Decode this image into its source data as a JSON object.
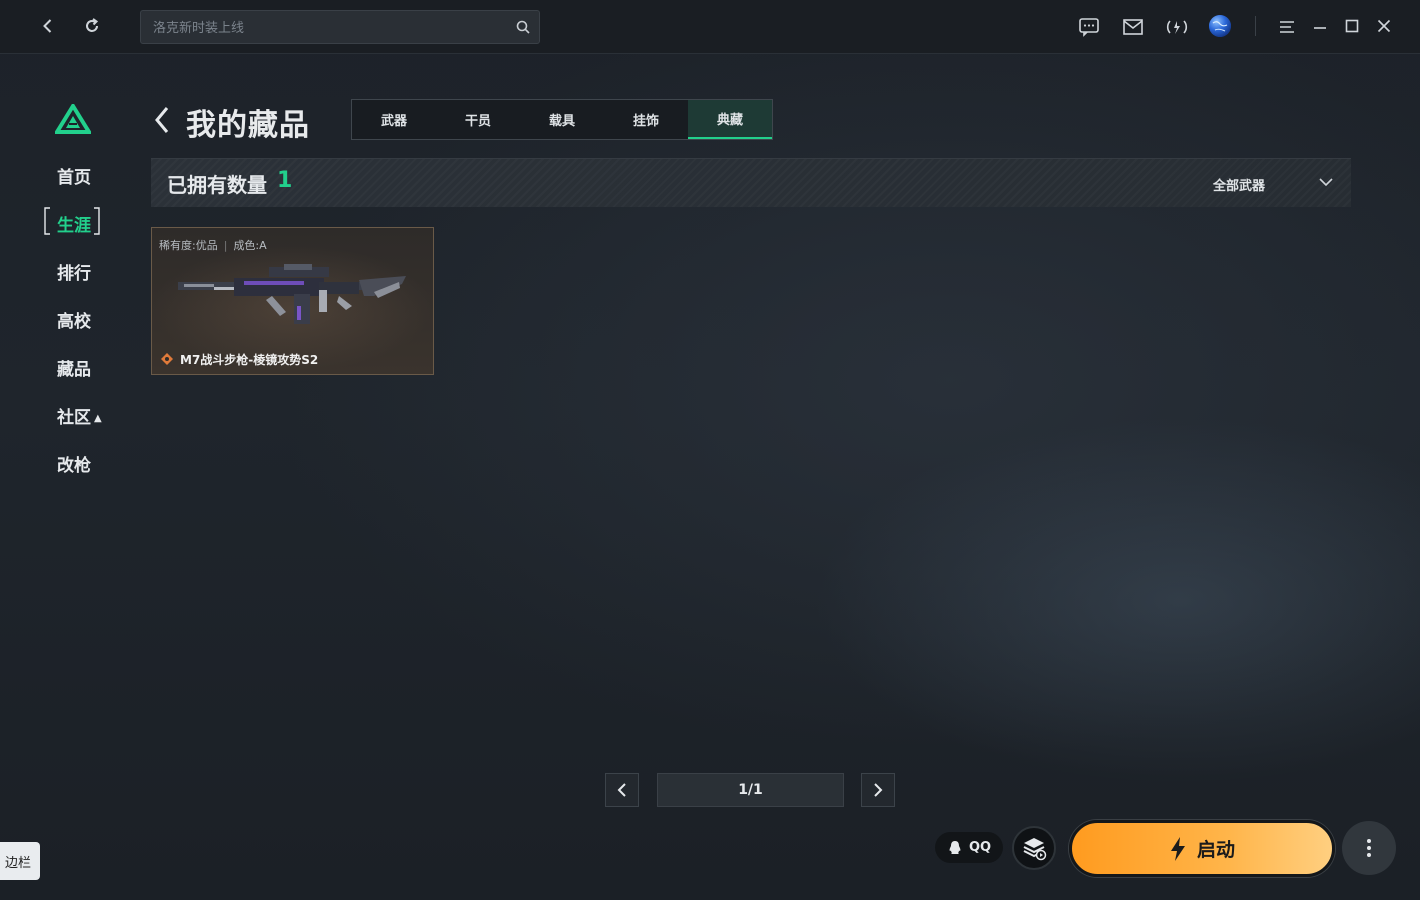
{
  "topbar": {
    "search_placeholder": "洛克新时装上线",
    "icons": [
      "back-icon",
      "refresh-icon",
      "search-icon",
      "chat-icon",
      "mail-icon",
      "signal-icon",
      "avatar-globe-icon",
      "menu-icon",
      "minimize-icon",
      "maximize-icon",
      "close-icon"
    ]
  },
  "sidebar": {
    "items": [
      {
        "label": "首页"
      },
      {
        "label": "生涯",
        "active": true
      },
      {
        "label": "排行"
      },
      {
        "label": "高校"
      },
      {
        "label": "藏品"
      },
      {
        "label": "社区"
      },
      {
        "label": "改枪"
      }
    ]
  },
  "header": {
    "title": "我的藏品",
    "tabs": [
      {
        "label": "武器"
      },
      {
        "label": "干员"
      },
      {
        "label": "载具"
      },
      {
        "label": "挂饰"
      },
      {
        "label": "典藏",
        "active": true
      }
    ]
  },
  "summary": {
    "label": "已拥有数量",
    "count": "1",
    "filter": "全部武器"
  },
  "items": [
    {
      "rarity": "稀有度:优品",
      "grade": "成色:A",
      "name": "M7战斗步枪-棱镜攻势S2"
    }
  ],
  "pagination": {
    "page": "1/1"
  },
  "bottom": {
    "sidebar_tip": "边栏",
    "qq_label": "QQ",
    "launch_label": "启动"
  },
  "colors": {
    "accent": "#22d08c",
    "launch": "#ffa531",
    "card_border": "#6a5a48"
  }
}
